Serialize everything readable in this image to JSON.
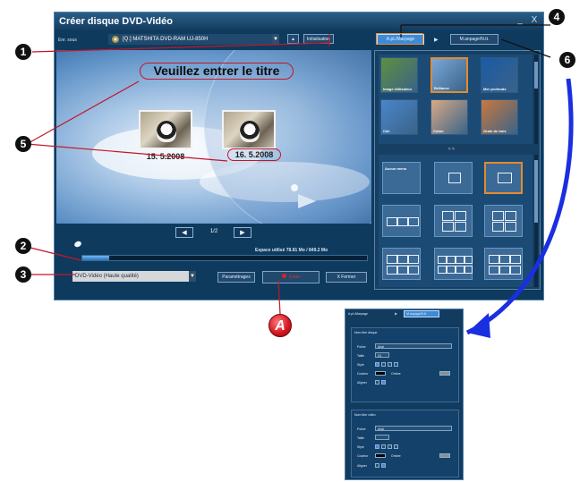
{
  "window": {
    "title": "Créer disque DVD-Vidéo",
    "minimize_label": "_",
    "close_label": "X"
  },
  "top_bar": {
    "save_to_label": "Enr. sous",
    "drive_value": "[Q:] MATSHITA DVD-RAM UJ-850H",
    "eject_label": "▲",
    "initialize_label": "Initialisation"
  },
  "preview": {
    "disc_title_placeholder": "Veuillez entrer le titre",
    "thumbnails": [
      {
        "date": "15. 5.2008"
      },
      {
        "date": "16. 5.2008"
      }
    ]
  },
  "pager": {
    "prev_label": "◀",
    "next_label": "▶",
    "page_text": "1/2"
  },
  "usage": {
    "label": "Espace utilisé  78.81 Mo / 849.2 Mo",
    "used_mb": 78.81,
    "total_mb": 849.2
  },
  "bottom_bar": {
    "quality_value": "DVD-Vidéo (Haute qualité)",
    "settings_label": "Paramétrages",
    "create_label": "Créer",
    "close_label": "X   Fermer"
  },
  "right_panel": {
    "tab_auto_layout": "A.pL/Marpage",
    "tab_separator": "▶",
    "tab_manual_layout": "M.anpage/N.tt.",
    "backgrounds": [
      {
        "label": "Image Utilisateur",
        "color": "#5f8f3f"
      },
      {
        "label": "Brillance",
        "color": "#7aa7d8"
      },
      {
        "label": "Mer profonde",
        "color": "#1b5aa6"
      },
      {
        "label": "Ciel",
        "color": "#4a86cc"
      },
      {
        "label": "Coton",
        "color": "#d8a987"
      },
      {
        "label": "Grain de bois",
        "color": "#c9783f"
      }
    ],
    "divider_label": "≈  ≈",
    "layouts": [
      {
        "label": "Aucun menu"
      },
      {
        "label": ""
      },
      {
        "label": ""
      },
      {
        "label": ""
      },
      {
        "label": ""
      },
      {
        "label": ""
      },
      {
        "label": ""
      },
      {
        "label": ""
      },
      {
        "label": ""
      }
    ]
  },
  "callouts": {
    "one": "1",
    "two": "2",
    "three": "3",
    "four": "4",
    "five": "5",
    "six": "6",
    "a": "A"
  },
  "settings_panel": {
    "tab_auto": "A.pL/Marpage",
    "tab_manual": "M.anpage/N.tt.",
    "disc_title_section": "Nom titre disque",
    "video_title_section": "Nom titre vidéo",
    "font_label": "Police",
    "font_value": "Arial",
    "size_label": "Taille",
    "size_value": "24",
    "style_label": "Style",
    "style_options": [
      "B",
      "I",
      "U",
      "S"
    ],
    "color_label": "Couleur",
    "shadow_label": "Ombre",
    "align_label": "Aligner"
  }
}
